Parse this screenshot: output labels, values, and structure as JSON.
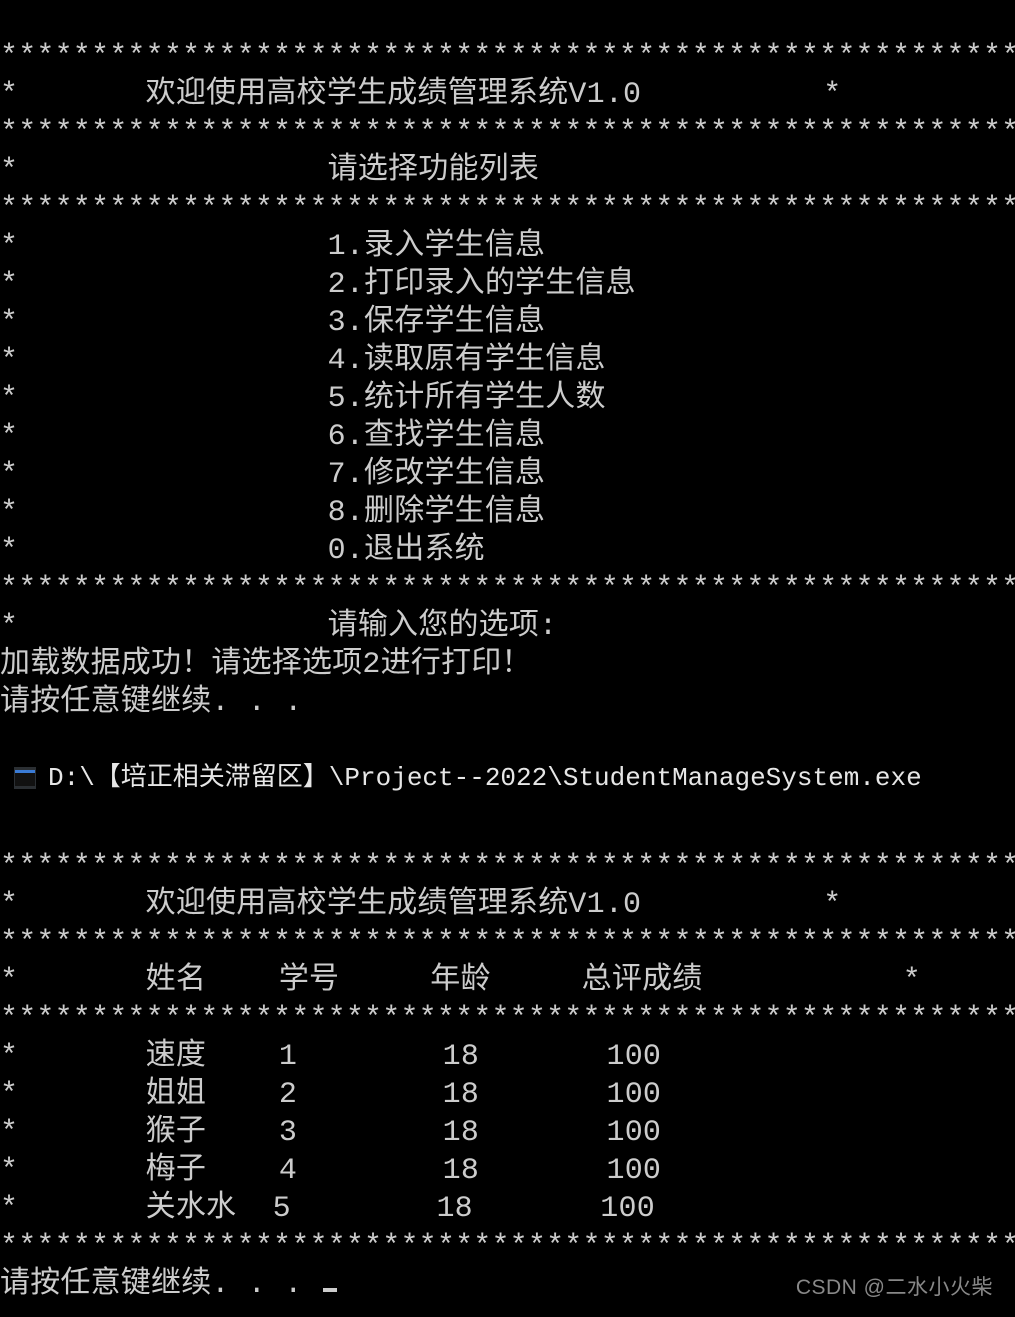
{
  "stars": "*****************************************************************",
  "top": {
    "title_line": "*       欢迎使用高校学生成绩管理系统V1.0          *",
    "select_line": "*                 请选择功能列表                                *",
    "menu": [
      "*                 1.录入学生信息                                *",
      "*                 2.打印录入的学生信息                          *",
      "*                 3.保存学生信息                                *",
      "*                 4.读取原有学生信息                            *",
      "*                 5.统计所有学生人数                            *",
      "*                 6.查找学生信息                                *",
      "*                 7.修改学生信息                                *",
      "*                 8.删除学生信息                                *",
      "*                 0.退出系统                                    *"
    ],
    "prompt_line": "*                 请输入您的选项:                               *",
    "loaded": "加载数据成功！请选择选项2进行打印！",
    "anykey": "请按任意键继续. . ."
  },
  "window_title": "D:\\【培正相关滞留区】\\Project--2022\\StudentManageSystem.exe",
  "bottom": {
    "title_line": "*       欢迎使用高校学生成绩管理系统V1.0          *",
    "header_line": "*       姓名    学号     年龄     总评成绩           *",
    "rows": [
      "*       速度    1        18       100                           *",
      "*       姐姐    2        18       100                           *",
      "*       猴子    3        18       100                           *",
      "*       梅子    4        18       100                           *",
      "*       关水水  5        18       100                           *"
    ],
    "anykey": "请按任意键继续. . . "
  },
  "watermark": "CSDN @二水小火柴",
  "table_data": {
    "type": "table",
    "columns": [
      "姓名",
      "学号",
      "年龄",
      "总评成绩"
    ],
    "rows": [
      {
        "姓名": "速度",
        "学号": 1,
        "年龄": 18,
        "总评成绩": 100
      },
      {
        "姓名": "姐姐",
        "学号": 2,
        "年龄": 18,
        "总评成绩": 100
      },
      {
        "姓名": "猴子",
        "学号": 3,
        "年龄": 18,
        "总评成绩": 100
      },
      {
        "姓名": "梅子",
        "学号": 4,
        "年龄": 18,
        "总评成绩": 100
      },
      {
        "姓名": "关水水",
        "学号": 5,
        "年龄": 18,
        "总评成绩": 100
      }
    ]
  }
}
